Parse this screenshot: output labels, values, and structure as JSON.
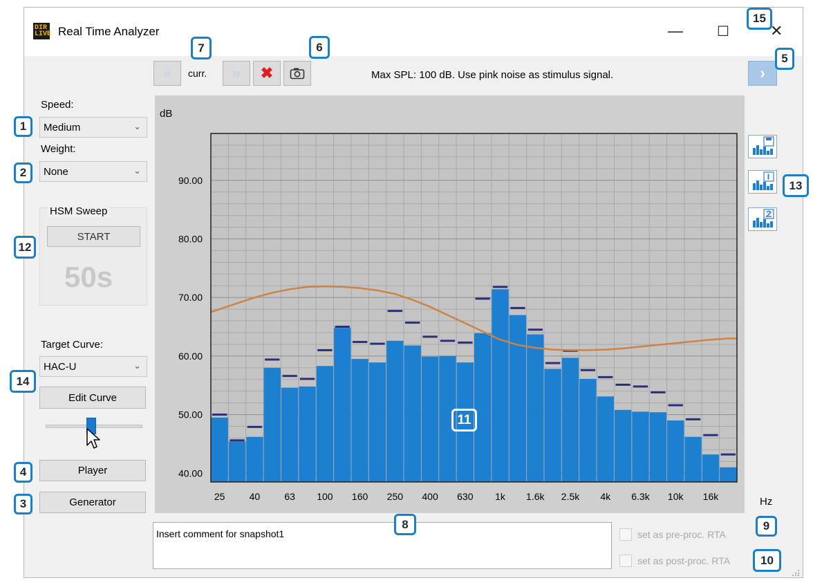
{
  "window": {
    "title": "Real Time Analyzer",
    "logo_text": "DIR LIVE",
    "minimize_glyph": "—",
    "maximize_glyph": "☐",
    "close_glyph": "✕"
  },
  "toolbar": {
    "prev_glyph": "«",
    "current_label": "curr.",
    "next_glyph": "»",
    "delete_glyph": "✖",
    "snapshot_icon": "camera-icon",
    "forward_glyph": "›",
    "status_message": "Max SPL: 100 dB. Use pink noise as stimulus signal."
  },
  "controls": {
    "speed_label": "Speed:",
    "speed_value": "Medium",
    "weight_label": "Weight:",
    "weight_value": "None",
    "hsm_title": "HSM Sweep",
    "hsm_start": "START",
    "hsm_time": "50s",
    "target_curve_label": "Target Curve:",
    "target_curve_value": "HAC-U",
    "edit_curve": "Edit Curve",
    "slider_value": 0.47,
    "player": "Player",
    "generator": "Generator"
  },
  "comment": {
    "text": "Insert comment for snapshot1"
  },
  "options": {
    "pre_label": "set as pre-proc. RTA",
    "post_label": "set as post-proc. RTA",
    "pre_checked": false,
    "post_checked": false
  },
  "callouts": [
    "1",
    "2",
    "3",
    "4",
    "5",
    "6",
    "7",
    "8",
    "9",
    "10",
    "11",
    "12",
    "13",
    "14",
    "15"
  ],
  "colors": {
    "bar": "#1c7fd0",
    "peak": "#2b2f78",
    "target_curve": "#cd8442",
    "callout_border": "#1c7fc3"
  },
  "chart_data": {
    "type": "bar",
    "y_unit_label": "dB",
    "x_unit_label": "Hz",
    "ylim": [
      38.5,
      98
    ],
    "y_ticks": [
      40,
      50,
      60,
      70,
      80,
      90
    ],
    "y_tick_labels": [
      "40.00",
      "50.00",
      "60.00",
      "70.00",
      "80.00",
      "90.00"
    ],
    "x_tick_labels": [
      "25",
      "40",
      "63",
      "100",
      "160",
      "250",
      "400",
      "630",
      "1k",
      "1.6k",
      "2.5k",
      "4k",
      "6.3k",
      "10k",
      "16k"
    ],
    "bands": [
      "25",
      "31.5",
      "40",
      "50",
      "63",
      "80",
      "100",
      "125",
      "160",
      "200",
      "250",
      "315",
      "400",
      "500",
      "630",
      "800",
      "1k",
      "1.25k",
      "1.6k",
      "2k",
      "2.5k",
      "3.15k",
      "4k",
      "5k",
      "6.3k",
      "8k",
      "10k",
      "12.5k",
      "16k",
      "20k"
    ],
    "values": [
      49.5,
      45.4,
      46.2,
      58.0,
      54.6,
      54.8,
      58.3,
      64.8,
      59.5,
      58.9,
      62.6,
      61.8,
      59.9,
      60.0,
      58.9,
      63.9,
      71.4,
      67.0,
      63.7,
      57.8,
      59.7,
      56.1,
      53.1,
      50.8,
      50.5,
      50.4,
      49.0,
      46.2,
      43.2,
      41.0
    ],
    "peaks": [
      50.0,
      45.6,
      47.9,
      59.4,
      56.6,
      56.1,
      61.0,
      65.0,
      62.4,
      62.1,
      67.7,
      65.7,
      63.3,
      62.6,
      62.3,
      69.8,
      71.8,
      68.2,
      64.5,
      58.8,
      60.9,
      57.6,
      56.4,
      55.1,
      54.8,
      53.8,
      51.6,
      49.2,
      46.5,
      43.2
    ],
    "target_curve": [
      68.0,
      69.0,
      70.0,
      70.8,
      71.4,
      71.8,
      71.9,
      71.8,
      71.6,
      71.2,
      70.6,
      69.6,
      68.4,
      67.0,
      65.6,
      64.2,
      62.8,
      61.9,
      61.4,
      61.1,
      61.0,
      61.0,
      61.1,
      61.3,
      61.6,
      61.9,
      62.2,
      62.5,
      62.8,
      63.0
    ],
    "grid": true
  }
}
